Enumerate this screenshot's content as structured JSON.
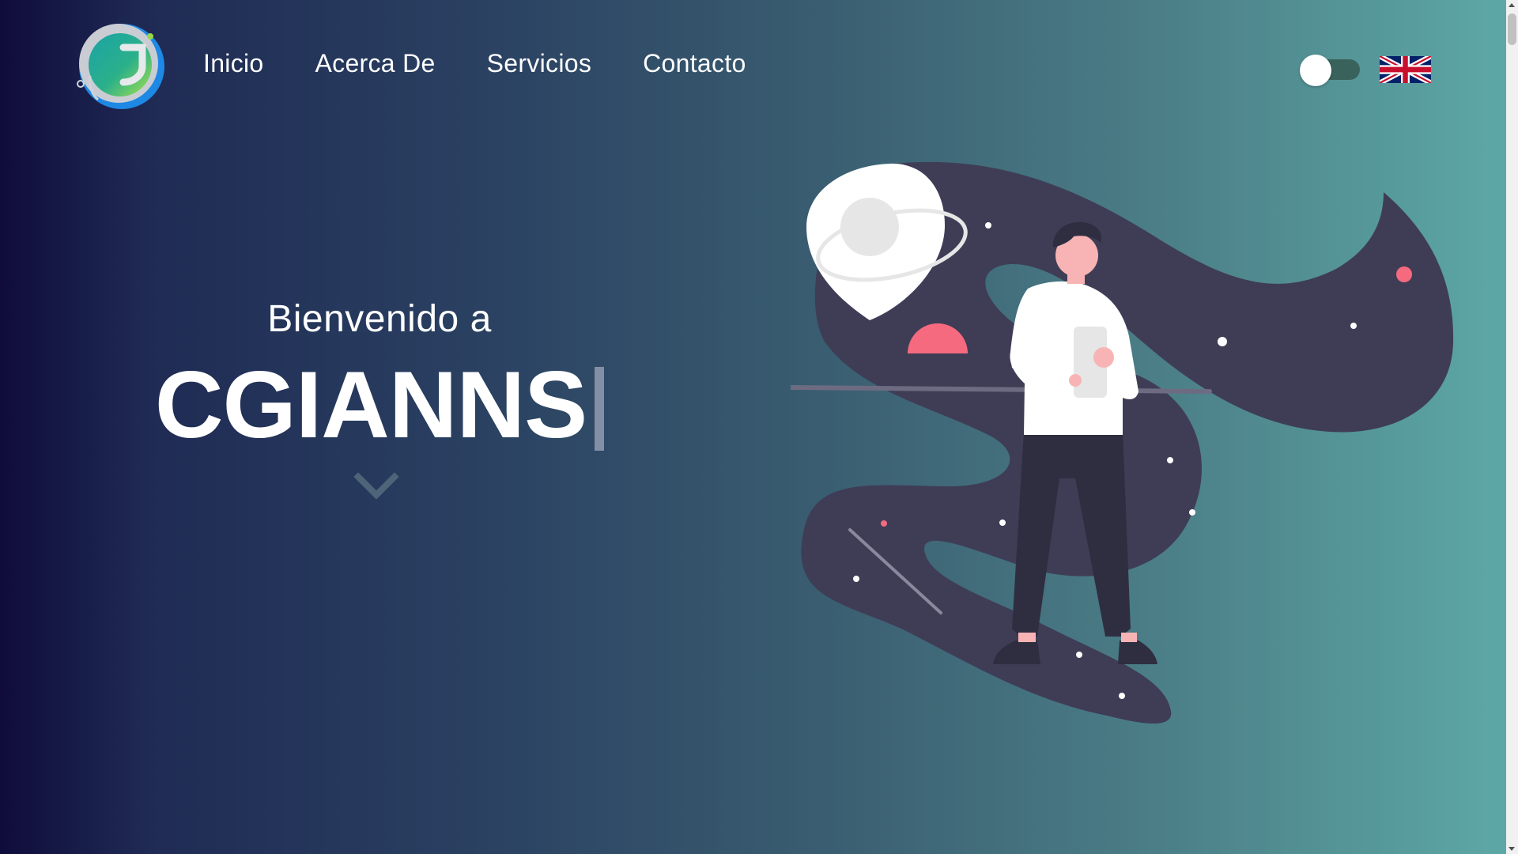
{
  "nav": {
    "items": [
      {
        "label": "Inicio"
      },
      {
        "label": "Acerca De"
      },
      {
        "label": "Servicios"
      },
      {
        "label": "Contacto"
      }
    ]
  },
  "controls": {
    "theme_toggle_icon": "toggle-switch",
    "language_icon": "uk-flag-icon"
  },
  "hero": {
    "welcome": "Bienvenido a",
    "brand": "CGIANNS",
    "scroll_icon": "chevron-down-icon"
  },
  "colors": {
    "gradient_start": "#0f0c3c",
    "gradient_end": "#5da8a6",
    "accent_pink": "#f56a7e",
    "illustration_dark": "#3f3d56"
  }
}
